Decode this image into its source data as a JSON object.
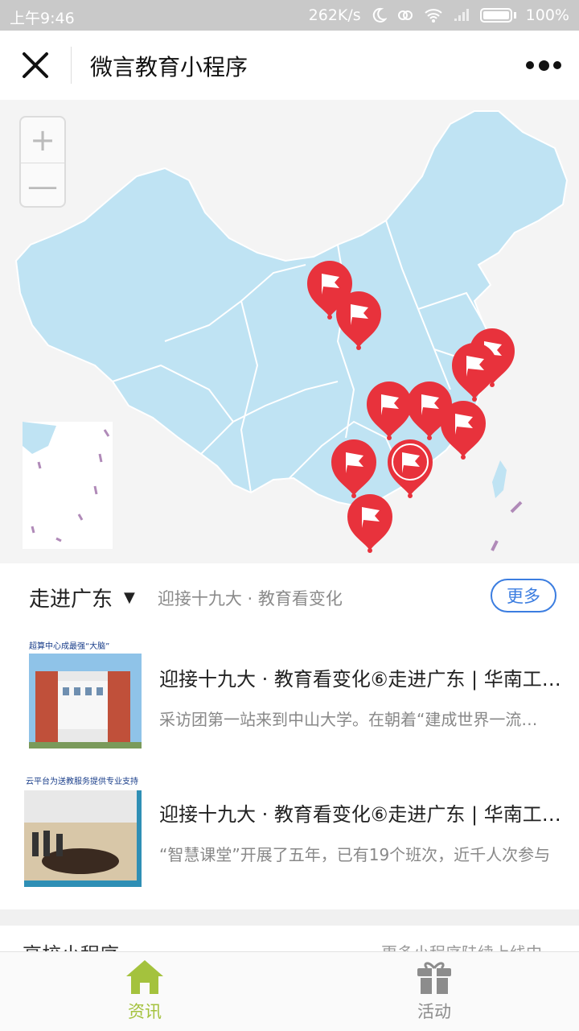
{
  "status_bar": {
    "time": "上午9:46",
    "speed": "262K/s",
    "battery": "100%"
  },
  "nav": {
    "title": "微言教育小程序",
    "close_icon": "close-icon",
    "more_icon": "more-dots-icon"
  },
  "map": {
    "zoom_in": "+",
    "zoom_out": "—",
    "land_color": "#bfe3f3",
    "pin_color": "#e8323c",
    "pin_count": 12
  },
  "section": {
    "title": "走进广东",
    "caret": "▼",
    "subtitle": "迎接十九大 · 教育看变化",
    "more_label": "更多"
  },
  "articles": [
    {
      "thumb_caption": "超算中心成最强“大脑”",
      "title": "迎接十九大 · 教育看变化⑥走进广东 | 华南工…",
      "desc": "采访团第一站来到中山大学。在朝着“建成世界一流大学”"
    },
    {
      "thumb_caption": "云平台为送教服务提供专业支持",
      "title": "迎接十九大 · 教育看变化⑥走进广东 | 华南工…",
      "desc": "“智慧课堂”开展了五年，已有19个班次，近千人次参与"
    }
  ],
  "next_section": {
    "title": "高校小程序",
    "note": "更多小程序陆续上线中"
  },
  "tabbar": {
    "tabs": [
      {
        "label": "资讯",
        "icon": "home-icon",
        "active": true,
        "color": "#a4c23d"
      },
      {
        "label": "活动",
        "icon": "gift-icon",
        "active": false,
        "color": "#8c8c8c"
      }
    ]
  }
}
